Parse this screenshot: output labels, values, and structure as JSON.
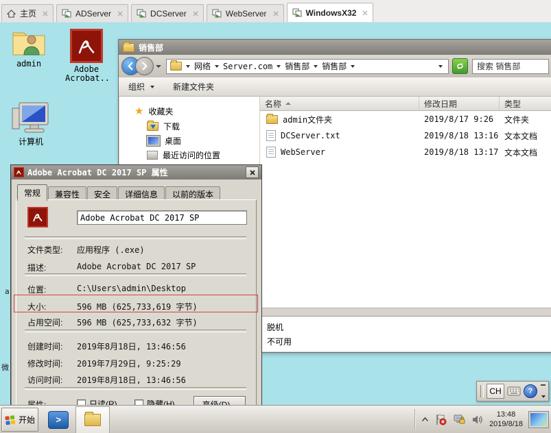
{
  "tabs": [
    {
      "label": "主页"
    },
    {
      "label": "ADServer"
    },
    {
      "label": "DCServer"
    },
    {
      "label": "WebServer"
    },
    {
      "label": "WindowsX32"
    }
  ],
  "desktop": {
    "icons": {
      "admin": "admin",
      "adobe": "Adobe Acrobat..",
      "computer": "计算机"
    },
    "fragments": {
      "a": "a",
      "wei": "微"
    }
  },
  "explorer": {
    "title": "销售部",
    "breadcrumb": {
      "root": "网络",
      "server": "Server.com",
      "dept": "销售部",
      "folder": "销售部"
    },
    "search_placeholder": "搜索 销售部",
    "toolbar": {
      "organize": "组织",
      "new_folder": "新建文件夹"
    },
    "sidebar": {
      "favorites": "收藏夹",
      "downloads": "下载",
      "desktop": "桌面",
      "recent": "最近访问的位置"
    },
    "columns": {
      "name": "名称",
      "date": "修改日期",
      "type": "类型"
    },
    "files": [
      {
        "name": "admin文件夹",
        "date": "2019/8/17 9:26",
        "type": "文件夹"
      },
      {
        "name": "DCServer.txt",
        "date": "2019/8/18 13:16",
        "type": "文本文档"
      },
      {
        "name": "WebServer",
        "date": "2019/8/18 13:17",
        "type": "文本文档"
      }
    ],
    "details": {
      "line1": "脱机",
      "line2": "不可用"
    }
  },
  "dialog": {
    "title": "Adobe Acrobat DC 2017 SP 属性",
    "tabs": [
      "常规",
      "兼容性",
      "安全",
      "详细信息",
      "以前的版本"
    ],
    "file_name": "Adobe Acrobat DC 2017 SP",
    "rows": [
      {
        "label": "文件类型:",
        "value": "应用程序 (.exe)"
      },
      {
        "label": "描述:",
        "value": "Adobe Acrobat DC 2017 SP"
      },
      {
        "label": "位置:",
        "value": "C:\\Users\\admin\\Desktop"
      },
      {
        "label": "大小:",
        "value": "596 MB (625,733,619 字节)"
      },
      {
        "label": "占用空间:",
        "value": "596 MB (625,733,632 字节)"
      },
      {
        "label": "创建时间:",
        "value": "2019年8月18日, 13:46:56"
      },
      {
        "label": "修改时间:",
        "value": "2019年7月29日, 9:25:29"
      },
      {
        "label": "访问时间:",
        "value": "2019年8月18日, 13:46:56"
      }
    ],
    "attributes": {
      "label": "属性:",
      "readonly": "只读(R)",
      "hidden": "隐藏(H)",
      "advanced": "高级(D)..."
    }
  },
  "taskbar": {
    "start": "开始",
    "clock": {
      "time": "13:48",
      "date": "2019/8/18"
    }
  },
  "langbar": {
    "lang": "CH",
    "help_glyph": "?"
  },
  "icons": {
    "ps_glyph": ">"
  },
  "colors": {
    "desktop": "#a9e2e9",
    "highlight_red": "#cc4444",
    "refresh_green": "#57a832",
    "adobe_red": "#8e1409"
  }
}
